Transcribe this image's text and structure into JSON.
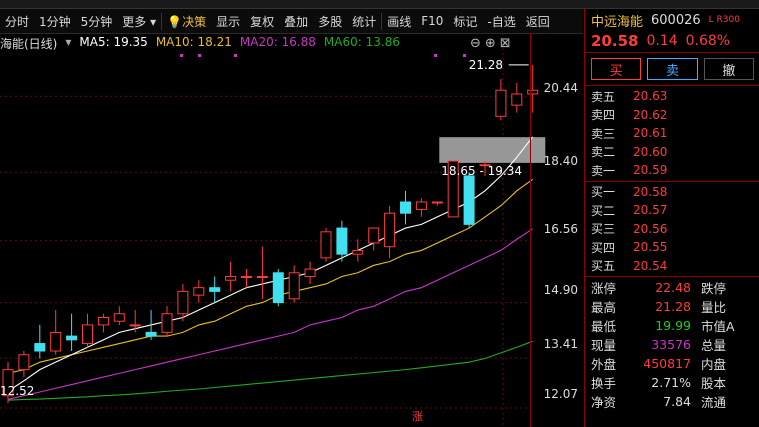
{
  "toolbar": {
    "items": [
      "分时",
      "1分钟",
      "5分钟",
      "更多",
      "决策",
      "显示",
      "复权",
      "叠加",
      "多股",
      "统计",
      "画线",
      "F10",
      "标记",
      "-自选",
      "返回"
    ]
  },
  "legend": {
    "title": "海能(日线)",
    "ma5": "MA5: 19.35",
    "ma10": "MA10: 18.21",
    "ma20": "MA20: 16.88",
    "ma60": "MA60: 13.86"
  },
  "annotations": {
    "high": "21.28",
    "gap": "18.65 - 19.34",
    "low_left": "12.52",
    "zhang": "涨"
  },
  "colors": {
    "up": "#ff3b3b",
    "down": "#40e0f0",
    "ma5": "#ffffff",
    "ma10": "#e8c020",
    "ma20": "#cc33cc",
    "ma60": "#22aa22"
  },
  "chart_data": {
    "type": "candlestick",
    "ylim": [
      12.07,
      21.6
    ],
    "y_ticks": [
      "20.44",
      "18.40",
      "16.56",
      "14.90",
      "13.41",
      "12.07"
    ],
    "candles": [
      {
        "o": 12.4,
        "c": 13.1,
        "h": 13.3,
        "l": 12.2
      },
      {
        "o": 13.1,
        "c": 13.5,
        "h": 13.6,
        "l": 12.9
      },
      {
        "o": 13.8,
        "c": 13.6,
        "h": 14.3,
        "l": 13.4
      },
      {
        "o": 13.6,
        "c": 14.1,
        "h": 14.7,
        "l": 13.5
      },
      {
        "o": 14.0,
        "c": 13.9,
        "h": 14.6,
        "l": 13.6
      },
      {
        "o": 13.8,
        "c": 14.3,
        "h": 14.6,
        "l": 13.7
      },
      {
        "o": 14.3,
        "c": 14.5,
        "h": 14.6,
        "l": 14.1
      },
      {
        "o": 14.4,
        "c": 14.6,
        "h": 14.8,
        "l": 14.3
      },
      {
        "o": 14.3,
        "c": 14.3,
        "h": 14.7,
        "l": 14.1
      },
      {
        "o": 14.1,
        "c": 14.0,
        "h": 14.7,
        "l": 13.9
      },
      {
        "o": 14.1,
        "c": 14.6,
        "h": 14.8,
        "l": 14.0
      },
      {
        "o": 14.6,
        "c": 15.2,
        "h": 15.4,
        "l": 14.4
      },
      {
        "o": 15.1,
        "c": 15.3,
        "h": 15.5,
        "l": 14.9
      },
      {
        "o": 15.3,
        "c": 15.2,
        "h": 15.6,
        "l": 14.9
      },
      {
        "o": 15.5,
        "c": 15.6,
        "h": 16.0,
        "l": 15.2
      },
      {
        "o": 15.6,
        "c": 15.6,
        "h": 15.8,
        "l": 15.3
      },
      {
        "o": 15.6,
        "c": 15.6,
        "h": 16.4,
        "l": 15.0
      },
      {
        "o": 15.7,
        "c": 14.9,
        "h": 15.8,
        "l": 14.8
      },
      {
        "o": 15.0,
        "c": 15.7,
        "h": 15.9,
        "l": 14.9
      },
      {
        "o": 15.6,
        "c": 15.8,
        "h": 16.0,
        "l": 15.4
      },
      {
        "o": 16.1,
        "c": 16.8,
        "h": 16.9,
        "l": 16.0
      },
      {
        "o": 16.9,
        "c": 16.2,
        "h": 17.1,
        "l": 16.0
      },
      {
        "o": 16.2,
        "c": 16.3,
        "h": 16.6,
        "l": 16.0
      },
      {
        "o": 16.5,
        "c": 16.9,
        "h": 16.9,
        "l": 16.3
      },
      {
        "o": 16.4,
        "c": 17.3,
        "h": 17.5,
        "l": 16.1
      },
      {
        "o": 17.6,
        "c": 17.3,
        "h": 17.9,
        "l": 17.0
      },
      {
        "o": 17.4,
        "c": 17.6,
        "h": 17.7,
        "l": 17.2
      },
      {
        "o": 17.6,
        "c": 17.6,
        "h": 17.6,
        "l": 17.5
      },
      {
        "o": 17.2,
        "c": 18.7,
        "h": 18.7,
        "l": 17.2
      },
      {
        "o": 18.3,
        "c": 17.0,
        "h": 18.4,
        "l": 16.9
      },
      {
        "o": 18.6,
        "c": 18.6,
        "h": 18.7,
        "l": 18.3
      },
      {
        "o": 19.9,
        "c": 20.6,
        "h": 20.9,
        "l": 19.8
      },
      {
        "o": 20.2,
        "c": 20.5,
        "h": 20.8,
        "l": 20.0
      },
      {
        "o": 20.5,
        "c": 20.6,
        "h": 21.28,
        "l": 20.0
      }
    ],
    "ma5": [
      12.52,
      12.8,
      13.1,
      13.3,
      13.5,
      13.7,
      13.9,
      14.1,
      14.2,
      14.3,
      14.4,
      14.5,
      14.7,
      14.9,
      15.1,
      15.3,
      15.4,
      15.5,
      15.6,
      15.7,
      15.9,
      16.1,
      16.3,
      16.5,
      16.7,
      16.9,
      17.0,
      17.2,
      17.4,
      17.6,
      17.9,
      18.3,
      18.8,
      19.35
    ],
    "ma10": [
      13.0,
      13.1,
      13.3,
      13.4,
      13.5,
      13.6,
      13.7,
      13.8,
      13.9,
      14.0,
      14.0,
      14.1,
      14.3,
      14.4,
      14.6,
      14.8,
      14.9,
      15.1,
      15.2,
      15.3,
      15.4,
      15.6,
      15.7,
      15.9,
      16.0,
      16.2,
      16.3,
      16.5,
      16.7,
      16.9,
      17.2,
      17.5,
      17.9,
      18.21
    ],
    "ma20": [
      12.3,
      12.4,
      12.5,
      12.6,
      12.7,
      12.8,
      12.9,
      13.0,
      13.1,
      13.2,
      13.3,
      13.4,
      13.5,
      13.6,
      13.7,
      13.8,
      13.9,
      14.0,
      14.1,
      14.3,
      14.4,
      14.5,
      14.7,
      14.8,
      15.0,
      15.2,
      15.3,
      15.5,
      15.7,
      15.9,
      16.1,
      16.3,
      16.6,
      16.88
    ],
    "ma60": [
      12.28,
      12.3,
      12.31,
      12.33,
      12.35,
      12.37,
      12.4,
      12.42,
      12.45,
      12.48,
      12.52,
      12.55,
      12.58,
      12.62,
      12.66,
      12.7,
      12.74,
      12.78,
      12.82,
      12.86,
      12.9,
      12.94,
      12.98,
      13.02,
      13.06,
      13.1,
      13.15,
      13.2,
      13.25,
      13.3,
      13.4,
      13.55,
      13.7,
      13.86
    ],
    "gap_box": {
      "low": 18.65,
      "high": 19.34
    }
  },
  "panel": {
    "name": "中远海能",
    "code": "600026",
    "tag": "L R300",
    "price": "20.58",
    "change": "0.14",
    "pct": "0.68%",
    "buttons": [
      "买",
      "卖",
      "撤"
    ],
    "asks": [
      {
        "label": "卖五",
        "price": "20.63"
      },
      {
        "label": "卖四",
        "price": "20.62"
      },
      {
        "label": "卖三",
        "price": "20.61"
      },
      {
        "label": "卖二",
        "price": "20.60"
      },
      {
        "label": "卖一",
        "price": "20.59"
      }
    ],
    "bids": [
      {
        "label": "买一",
        "price": "20.58"
      },
      {
        "label": "买二",
        "price": "20.57"
      },
      {
        "label": "买三",
        "price": "20.56"
      },
      {
        "label": "买四",
        "price": "20.55"
      },
      {
        "label": "买五",
        "price": "20.54"
      }
    ],
    "stats": [
      {
        "k": "涨停",
        "v": "22.48",
        "k2": "跌停",
        "color": "#ff3b3b"
      },
      {
        "k": "最高",
        "v": "21.28",
        "k2": "量比",
        "color": "#ff3b3b"
      },
      {
        "k": "最低",
        "v": "19.99",
        "k2": "市值A",
        "color": "#22cc22"
      },
      {
        "k": "现量",
        "v": "33576",
        "k2": "总量",
        "color": "#cc33cc"
      },
      {
        "k": "外盘",
        "v": "450817",
        "k2": "内盘",
        "color": "#ff3b3b"
      },
      {
        "k": "换手",
        "v": "2.71%",
        "k2": "股本",
        "color": "#dddddd"
      },
      {
        "k": "净资",
        "v": "7.84",
        "k2": "流通",
        "color": "#dddddd"
      }
    ]
  }
}
